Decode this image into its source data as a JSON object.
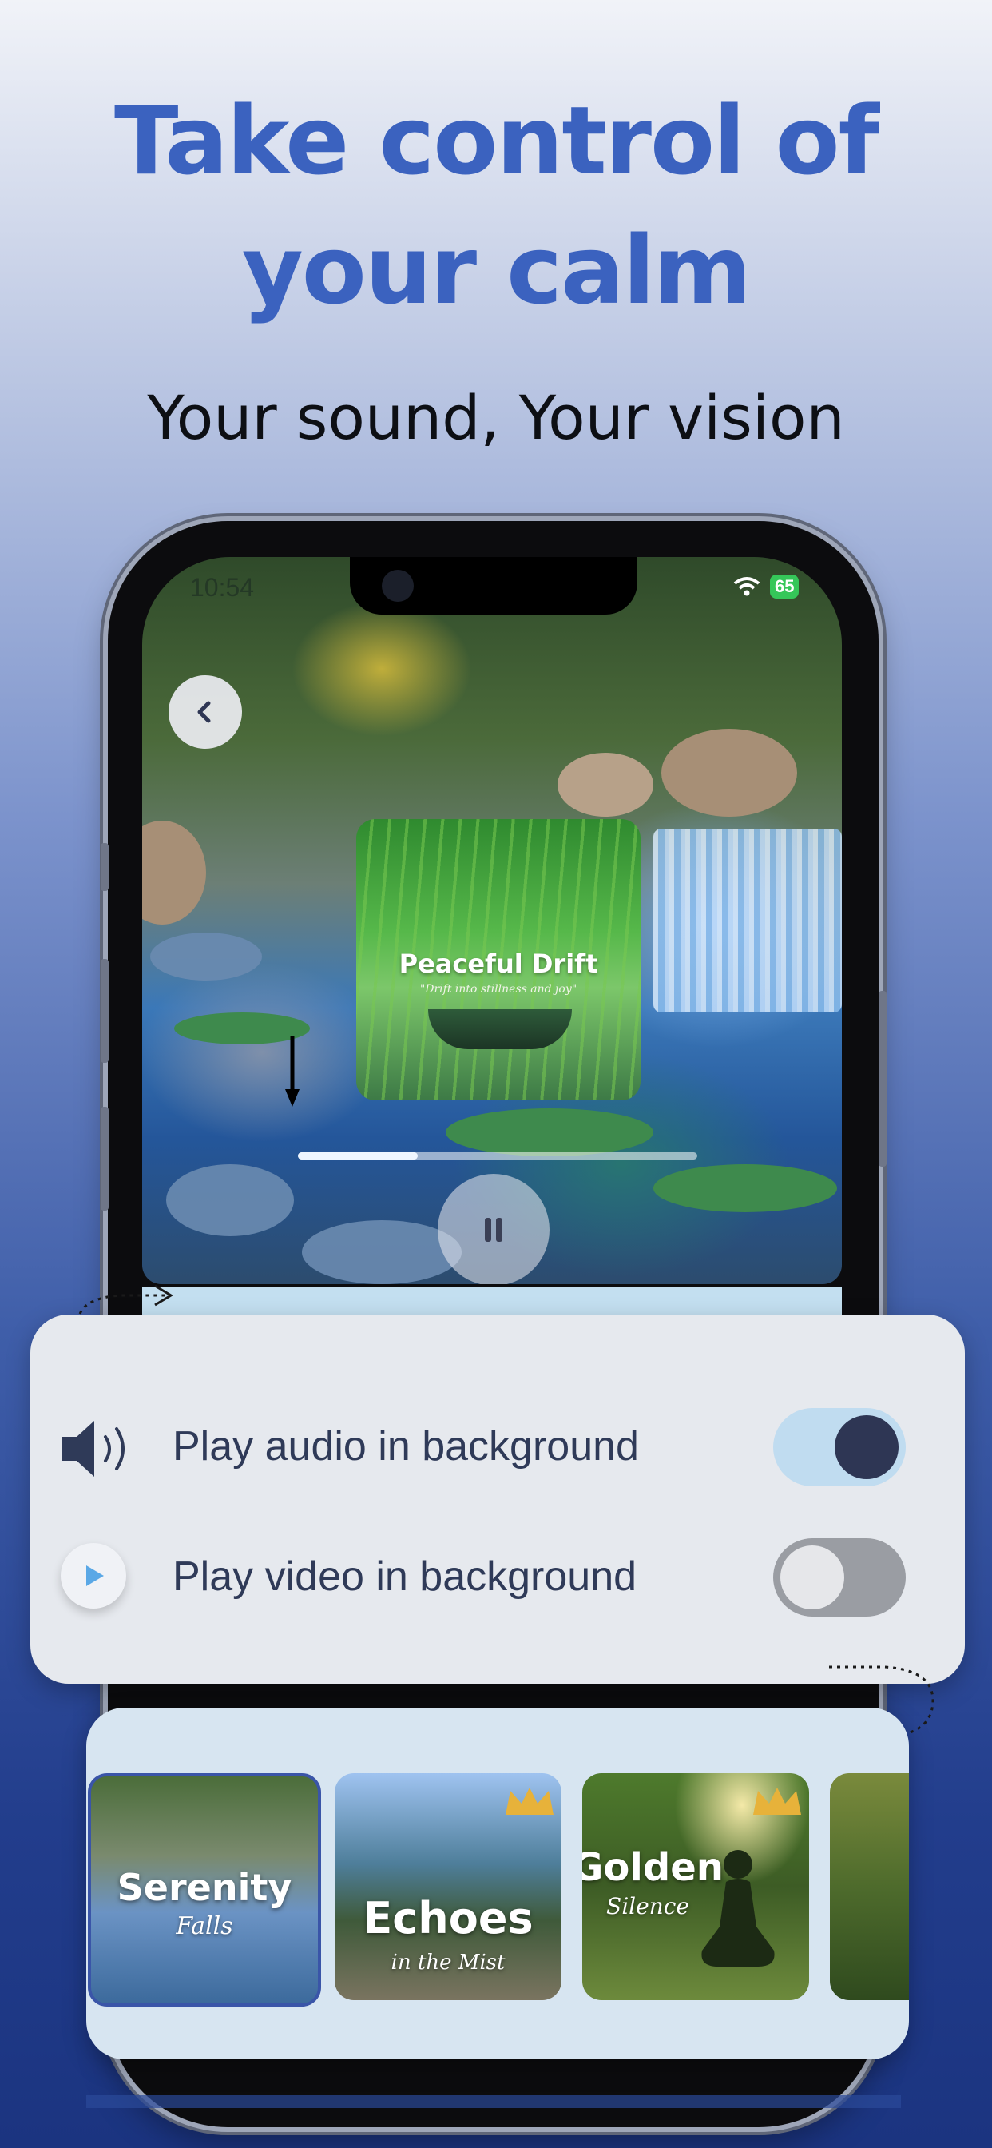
{
  "headline": {
    "line1": "Take control of",
    "line2": "your calm"
  },
  "subheadline": "Your sound, Your vision",
  "phone": {
    "status": {
      "time": "10:54",
      "battery": "65"
    },
    "player": {
      "album_title": "Peaceful Drift",
      "album_subtitle": "\"Drift into stillness and joy\"",
      "progress": 0.3
    }
  },
  "settings": {
    "audio_label": "Play audio in background",
    "audio_enabled": true,
    "video_label": "Play video in background",
    "video_enabled": false
  },
  "tracks": [
    {
      "title": "Serenity",
      "subtitle": "Falls",
      "premium": false
    },
    {
      "title": "Echoes",
      "subtitle": "in the Mist",
      "premium": true
    },
    {
      "title": "Golden",
      "subtitle": "Silence",
      "premium": true
    },
    {
      "title": "",
      "subtitle": "",
      "premium": false
    }
  ],
  "colors": {
    "headline": "#3b62bf",
    "toggle_on_track": "#c0dcf0",
    "toggle_on_knob": "#2e3654",
    "toggle_off_track": "#9a9da3",
    "toggle_off_knob": "#e6e7ea"
  }
}
